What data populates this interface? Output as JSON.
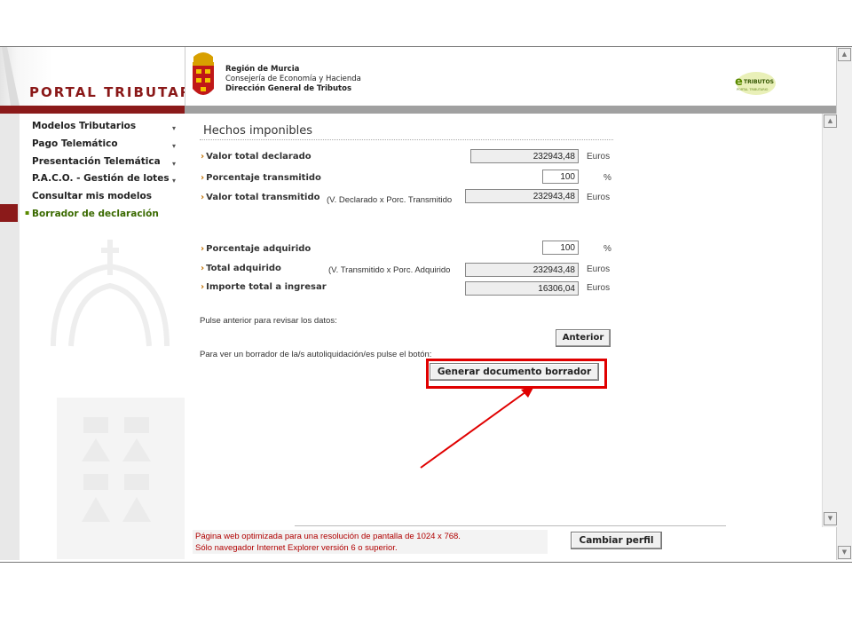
{
  "sidebar": {
    "title": "PORTAL TRIBUTARIO",
    "items": [
      {
        "label": "Modelos Tributarios",
        "has_arrow": true
      },
      {
        "label": "Pago Telemático",
        "has_arrow": true
      },
      {
        "label": "Presentación Telemática",
        "has_arrow": true
      },
      {
        "label": "P.A.C.O. - Gestión de lotes",
        "has_arrow": true
      },
      {
        "label": "Consultar mis modelos",
        "has_arrow": false
      },
      {
        "label": "Borrador de declaración",
        "has_arrow": false,
        "active": true
      }
    ],
    "arrow_glyph": "▾",
    "active_bullet": "▪"
  },
  "header": {
    "line1": "Región de Murcia",
    "line2": "Consejería de Economía y Hacienda",
    "line3": "Dirección General de Tributos",
    "etributos_logo": "e-TRIBUTOS",
    "etributos_sub": "PORTAL TRIBUTARIO"
  },
  "main": {
    "section_title": "Hechos imponibles",
    "arrow_glyph": "›",
    "rows": {
      "valor_total_declarado": {
        "label": "Valor total declarado",
        "value": "232943,48",
        "unit": "Euros"
      },
      "porcentaje_transmitido": {
        "label": "Porcentaje transmitido",
        "value": "100",
        "unit": "%"
      },
      "valor_total_transmitido": {
        "label": "Valor total transmitido",
        "note": "(V. Declarado x Porc. Transmitido",
        "value": "232943,48",
        "unit": "Euros"
      },
      "porcentaje_adquirido": {
        "label": "Porcentaje adquirido",
        "value": "100",
        "unit": "%"
      },
      "total_adquirido": {
        "label": "Total adquirido",
        "note": "(V. Transmitido x Porc. Adquirido",
        "value": "232943,48",
        "unit": "Euros"
      },
      "importe_total": {
        "label": "Importe total a ingresar",
        "value": "16306,04",
        "unit": "Euros"
      }
    },
    "review_text": "Pulse anterior para revisar los datos:",
    "anterior_label": "Anterior",
    "draft_text": "Para ver un borrador de la/s autoliquidación/es pulse el botón:",
    "generar_label": "Generar documento borrador"
  },
  "footer": {
    "line1": "Página web optimizada para una resolución de pantalla de 1024 x 768.",
    "line2": "Sólo navegador Internet Explorer versión 6 o superior.",
    "cambiar_label": "Cambiar perfil"
  },
  "annotation": {
    "highlight_color": "#e00000"
  },
  "scrollbar": {
    "up": "▲",
    "down": "▼"
  }
}
